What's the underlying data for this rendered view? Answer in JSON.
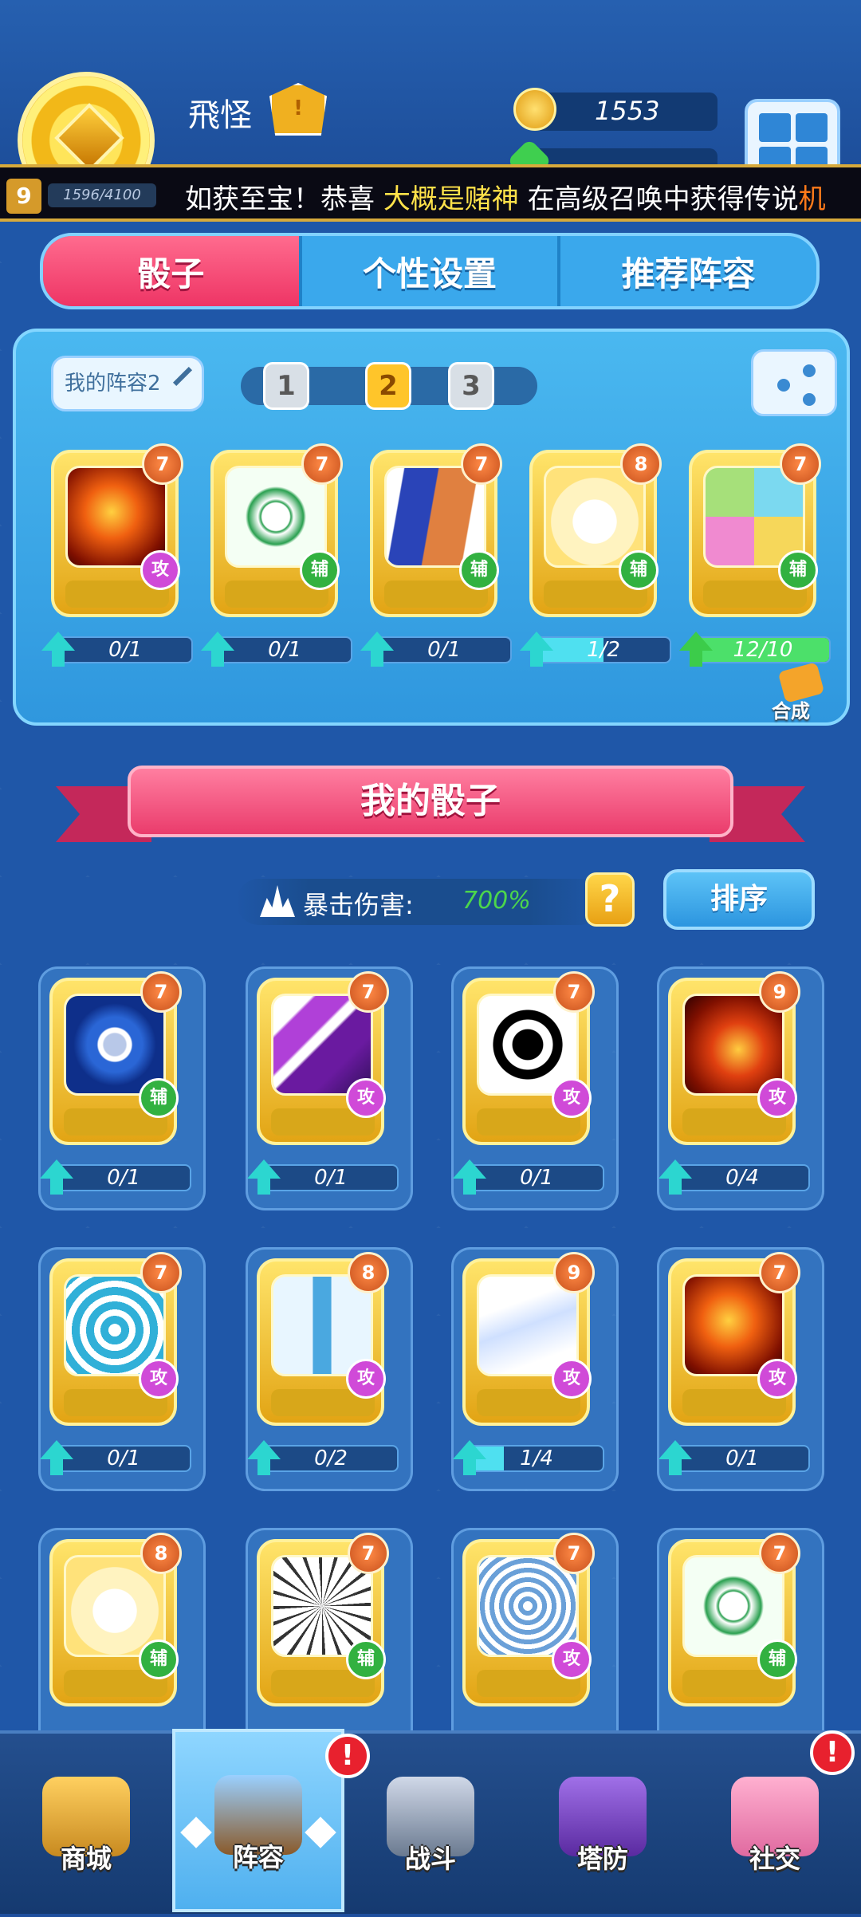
{
  "player": {
    "name": "飛怪",
    "rank_icon": "crown-shield-icon",
    "level": "9",
    "exp_text": "1596/4100"
  },
  "currency": {
    "coins": "1553",
    "coin_icon": "coin-plus-icon",
    "gems": "",
    "gem_icon": "green-gem-icon"
  },
  "ticker": {
    "part1": "如获至宝！恭喜 ",
    "part2": "大概是赌神",
    "part3": " 在高级召唤中获得传说",
    "part4": "机"
  },
  "tabs": [
    {
      "label": "骰子",
      "active": true
    },
    {
      "label": "个性设置",
      "active": false
    },
    {
      "label": "推荐阵容",
      "active": false
    }
  ],
  "lineup": {
    "name": "我的阵容2",
    "pages": [
      "1",
      "2",
      "3"
    ],
    "active_page": "2",
    "synth_label": "合成",
    "dice": [
      {
        "art": "fire-dragon",
        "level": "7",
        "tag": "攻",
        "progress": "0/1",
        "fill": 0,
        "arrow": "cyan"
      },
      {
        "art": "green-mandala",
        "level": "7",
        "tag": "辅",
        "progress": "0/1",
        "fill": 0,
        "arrow": "cyan"
      },
      {
        "art": "blue-orange-figures",
        "level": "7",
        "tag": "辅",
        "progress": "0/1",
        "fill": 0,
        "arrow": "cyan"
      },
      {
        "art": "lucky-cat",
        "level": "8",
        "tag": "辅",
        "progress": "1/2",
        "fill": 0.5,
        "arrow": "cyan"
      },
      {
        "art": "puzzle",
        "level": "7",
        "tag": "辅",
        "progress": "12/10",
        "fill": 1,
        "arrow": "green"
      }
    ]
  },
  "my_dice": {
    "title": "我的骰子",
    "crit_label": "暴击伤害:",
    "crit_value": "700%",
    "help": "?",
    "sort_label": "排序",
    "dice": [
      {
        "art": "blue-s-coin",
        "level": "7",
        "tag": "辅",
        "progress": "0/1",
        "fill": 0
      },
      {
        "art": "purple-rays",
        "level": "7",
        "tag": "攻",
        "progress": "0/1",
        "fill": 0
      },
      {
        "art": "yin-yang",
        "level": "7",
        "tag": "攻",
        "progress": "0/1",
        "fill": 0
      },
      {
        "art": "fire-burst",
        "level": "9",
        "tag": "攻",
        "progress": "0/4",
        "fill": 0
      },
      {
        "art": "ice-vortex",
        "level": "7",
        "tag": "攻",
        "progress": "0/1",
        "fill": 0
      },
      {
        "art": "ice-sword",
        "level": "8",
        "tag": "攻",
        "progress": "0/2",
        "fill": 0
      },
      {
        "art": "stars",
        "level": "9",
        "tag": "攻",
        "progress": "1/4",
        "fill": 0.25
      },
      {
        "art": "fire-dragon",
        "level": "7",
        "tag": "攻",
        "progress": "0/1",
        "fill": 0
      },
      {
        "art": "lucky-cat",
        "level": "8",
        "tag": "辅",
        "progress": "",
        "fill": 0
      },
      {
        "art": "thorn-wheel",
        "level": "7",
        "tag": "辅",
        "progress": "",
        "fill": 0
      },
      {
        "art": "blue-sun",
        "level": "7",
        "tag": "攻",
        "progress": "",
        "fill": 0
      },
      {
        "art": "green-mandala",
        "level": "7",
        "tag": "辅",
        "progress": "",
        "fill": 0
      }
    ]
  },
  "nav": [
    {
      "label": "商城",
      "icon": "shop-chest-icon",
      "active": false,
      "alert": false
    },
    {
      "label": "阵容",
      "icon": "cannon-icon",
      "active": true,
      "alert": true
    },
    {
      "label": "战斗",
      "icon": "crossed-swords-icon",
      "active": false,
      "alert": false
    },
    {
      "label": "塔防",
      "icon": "purple-tower-icon",
      "active": false,
      "alert": false
    },
    {
      "label": "社交",
      "icon": "pink-pig-icon",
      "active": false,
      "alert": true
    }
  ],
  "alert_mark": "!",
  "colors": {
    "accent_pink": "#ee3565",
    "panel_blue": "#3aa8ec",
    "gold": "#e2a414",
    "atk_tag": "#d04ad8",
    "sup_tag": "#32b140"
  }
}
